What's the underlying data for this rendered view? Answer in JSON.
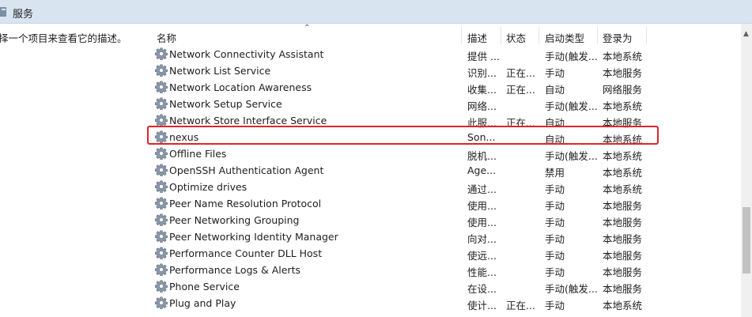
{
  "window": {
    "title": "服务"
  },
  "left_pane": {
    "description": "择一个项目来查看它的描述。"
  },
  "columns": {
    "name": "名称",
    "description": "描述",
    "status": "状态",
    "startup_type": "启动类型",
    "logon_as": "登录为"
  },
  "rows": [
    {
      "name": "Network Connectivity Assistant",
      "description": "提供 ...",
      "status": "",
      "startup": "手动(触发...",
      "logon": "本地系统"
    },
    {
      "name": "Network List Service",
      "description": "识别...",
      "status": "正在...",
      "startup": "手动",
      "logon": "本地服务"
    },
    {
      "name": "Network Location Awareness",
      "description": "收集...",
      "status": "正在...",
      "startup": "自动",
      "logon": "网络服务"
    },
    {
      "name": "Network Setup Service",
      "description": "网络...",
      "status": "",
      "startup": "手动(触发...",
      "logon": "本地系统"
    },
    {
      "name": "Network Store Interface Service",
      "description": "此服...",
      "status": "正在...",
      "startup": "自动",
      "logon": "本地服务"
    },
    {
      "name": "nexus",
      "description": "Son...",
      "status": "",
      "startup": "自动",
      "logon": "本地系统"
    },
    {
      "name": "Offline Files",
      "description": "脱机...",
      "status": "",
      "startup": "手动(触发...",
      "logon": "本地系统"
    },
    {
      "name": "OpenSSH Authentication Agent",
      "description": "Age...",
      "status": "",
      "startup": "禁用",
      "logon": "本地系统"
    },
    {
      "name": "Optimize drives",
      "description": "通过...",
      "status": "",
      "startup": "手动",
      "logon": "本地系统"
    },
    {
      "name": "Peer Name Resolution Protocol",
      "description": "使用...",
      "status": "",
      "startup": "手动",
      "logon": "本地服务"
    },
    {
      "name": "Peer Networking Grouping",
      "description": "使用...",
      "status": "",
      "startup": "手动",
      "logon": "本地服务"
    },
    {
      "name": "Peer Networking Identity Manager",
      "description": "向对...",
      "status": "",
      "startup": "手动",
      "logon": "本地服务"
    },
    {
      "name": "Performance Counter DLL Host",
      "description": "使远...",
      "status": "",
      "startup": "手动",
      "logon": "本地服务"
    },
    {
      "name": "Performance Logs & Alerts",
      "description": "性能...",
      "status": "",
      "startup": "手动",
      "logon": "本地服务"
    },
    {
      "name": "Phone Service",
      "description": "在设...",
      "status": "",
      "startup": "手动(触发...",
      "logon": "本地服务"
    },
    {
      "name": "Plug and Play",
      "description": "使计...",
      "status": "正在...",
      "startup": "手动",
      "logon": "本地系统"
    }
  ],
  "highlighted_row": "nexus",
  "icons": {
    "service": "gear-icon",
    "sort": "sort-ascending-icon"
  },
  "colors": {
    "highlight_border": "#e0242b",
    "titlebar": "#d9e4f1"
  }
}
